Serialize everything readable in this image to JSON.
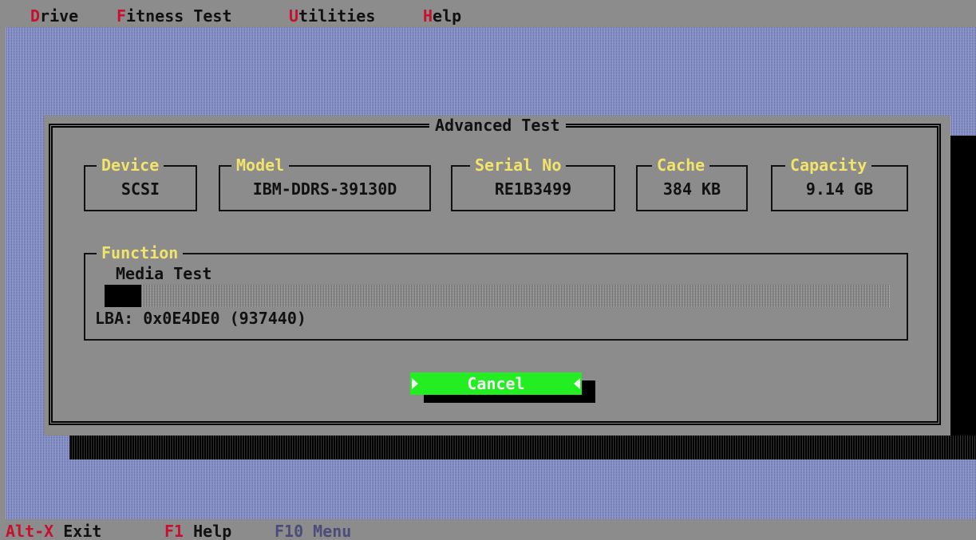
{
  "menu": [
    {
      "hotkey": "D",
      "rest": "rive"
    },
    {
      "hotkey": "F",
      "rest": "itness Test"
    },
    {
      "hotkey": "U",
      "rest": "tilities"
    },
    {
      "hotkey": "H",
      "rest": "elp"
    }
  ],
  "dialog": {
    "title": "Advanced Test",
    "device": {
      "label": "Device",
      "value": "SCSI"
    },
    "model": {
      "label": "Model",
      "value": "IBM-DDRS-39130D"
    },
    "serial": {
      "label": "Serial No",
      "value": "RE1B3499"
    },
    "cache": {
      "label": "Cache",
      "value": "384 KB"
    },
    "capacity": {
      "label": "Capacity",
      "value": "9.14 GB"
    },
    "function": {
      "label": "Function",
      "name": "Media Test",
      "progress_fraction": 0.047,
      "lba": "LBA: 0x0E4DE0 (937440)"
    },
    "cancel_label": "Cancel"
  },
  "statusbar": [
    {
      "key": "Alt-X",
      "label": "Exit"
    },
    {
      "key": "F1",
      "label": "Help"
    },
    {
      "key": "F10",
      "label": "Menu"
    }
  ],
  "colors": {
    "background": "#8c8c8c",
    "desktop": "#7d86b8",
    "hotkey": "#c8102e",
    "field_label": "#f2e36a",
    "button": "#22ee22"
  }
}
